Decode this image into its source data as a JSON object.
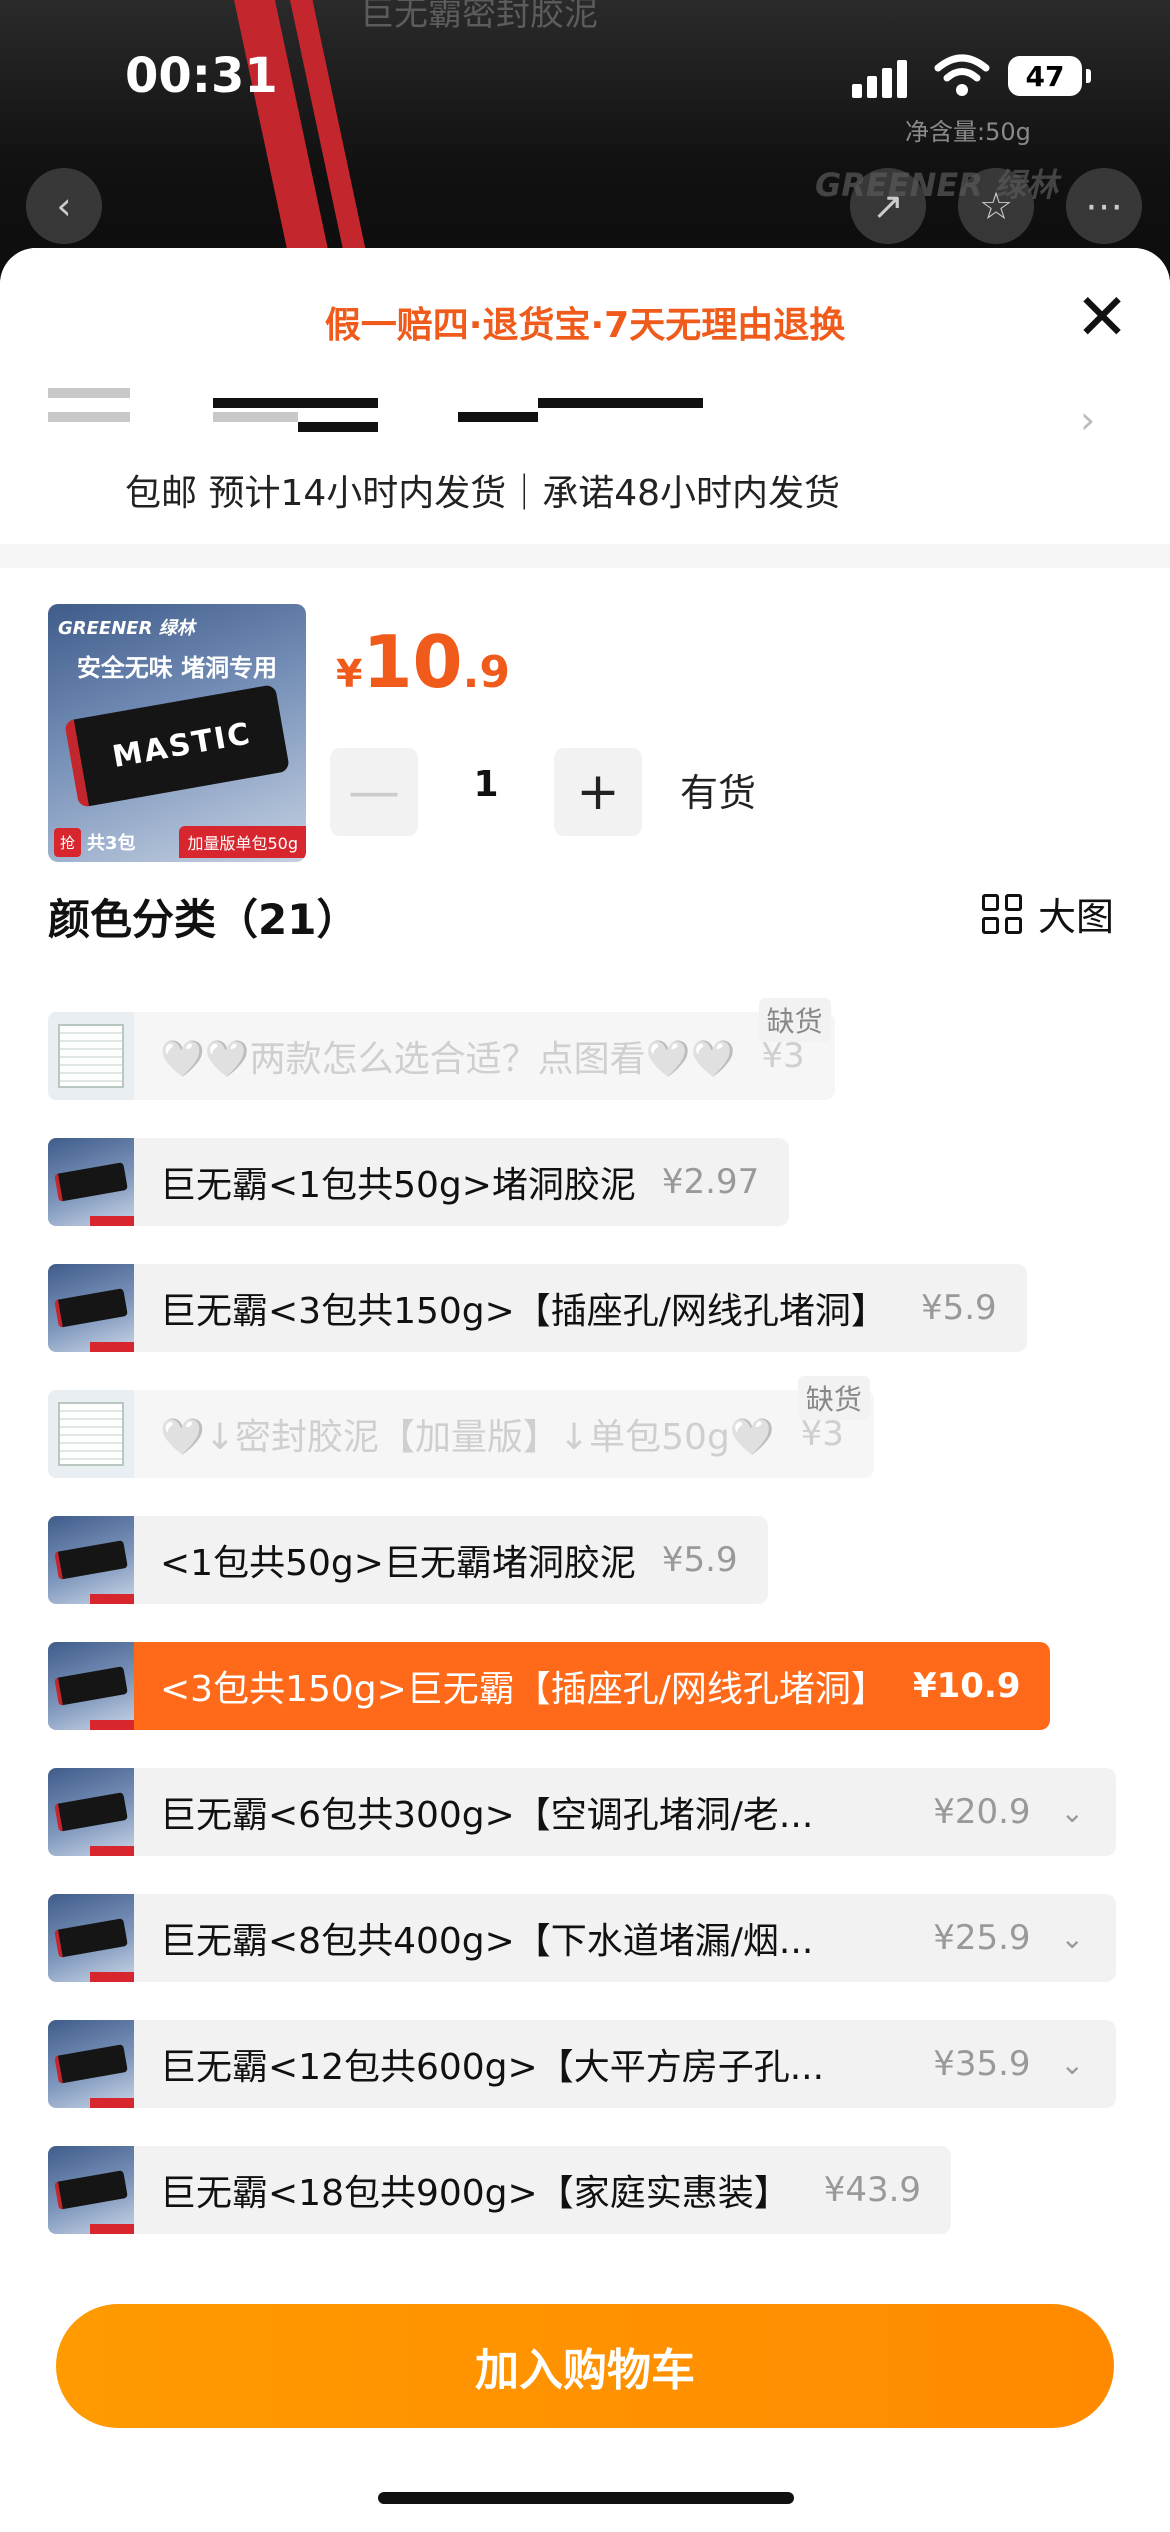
{
  "status_bar": {
    "time": "00:31",
    "battery": "47"
  },
  "background": {
    "title": "巨无霸密封胶泥",
    "net_weight": "净含量:50g",
    "brand": "GREENER 绿林"
  },
  "sheet": {
    "guarantee": "假一赔四·退货宝·7天无理由退换",
    "close": "✕",
    "shipping": "包邮 预计14小时内发货｜承诺48小时内发货"
  },
  "product": {
    "thumb_brand": "GREENER 绿林",
    "thumb_headline": "安全无味 堵洞专用",
    "thumb_pack": "MASTIC",
    "thumb_grab": "抢",
    "thumb_count": "共3包",
    "thumb_label": "加量版单包50g",
    "price_currency": "¥",
    "price_int": "10",
    "price_dec": ".9",
    "quantity": "1",
    "minus": "—",
    "plus": "+",
    "stock": "有货"
  },
  "section": {
    "title": "颜色分类（21）",
    "big_view": "大图"
  },
  "variants": [
    {
      "name": "🤍🤍两款怎么选合适？点图看🤍🤍",
      "price": "¥3",
      "badge": "缺货",
      "state": "disabled"
    },
    {
      "name": "巨无霸<1包共50g>堵洞胶泥",
      "price": "¥2.97",
      "state": "normal"
    },
    {
      "name": "巨无霸<3包共150g>【插座孔/网线孔堵洞】",
      "price": "¥5.9",
      "state": "normal"
    },
    {
      "name": "🤍↓密封胶泥【加量版】↓单包50g🤍",
      "price": "¥3",
      "badge": "缺货",
      "state": "disabled"
    },
    {
      "name": "<1包共50g>巨无霸堵洞胶泥",
      "price": "¥5.9",
      "state": "normal"
    },
    {
      "name": "<3包共150g>巨无霸【插座孔/网线孔堵洞】",
      "price": "¥10.9",
      "state": "selected"
    },
    {
      "name": "巨无霸<6包共300g>【空调孔堵洞/老...",
      "price": "¥20.9",
      "state": "normal"
    },
    {
      "name": "巨无霸<8包共400g>【下水道堵漏/烟...",
      "price": "¥25.9",
      "state": "normal"
    },
    {
      "name": "巨无霸<12包共600g>【大平方房子孔...",
      "price": "¥35.9",
      "state": "normal"
    },
    {
      "name": "巨无霸<18包共900g>【家庭实惠装】",
      "price": "¥43.9",
      "state": "normal"
    }
  ],
  "cart_button": "加入购物车",
  "colors": {
    "accent": "#f05a1a",
    "selected": "#ff6a1a",
    "cart": "#ff8a00"
  }
}
